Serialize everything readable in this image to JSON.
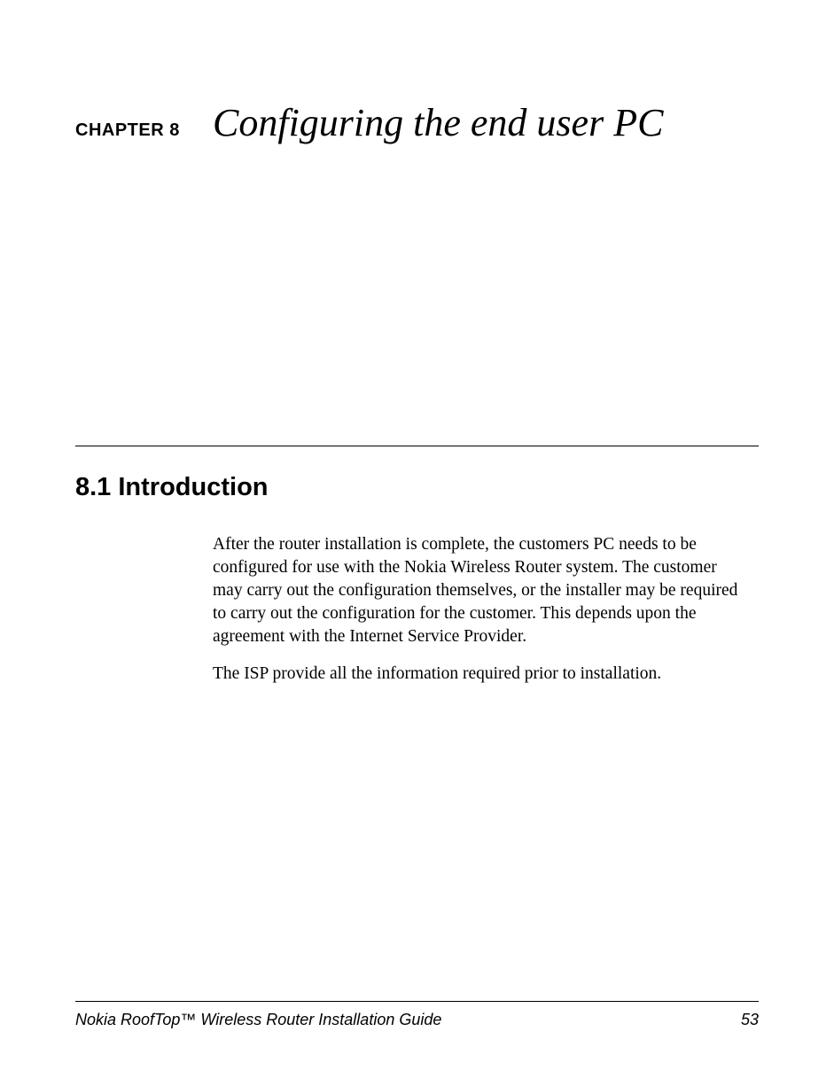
{
  "header": {
    "chapter_label": "CHAPTER 8",
    "chapter_title": "Configuring the end user PC"
  },
  "section": {
    "heading": "8.1 Introduction",
    "paragraphs": [
      "After the router installation is complete, the customers PC needs to be configured for use with the Nokia Wireless Router system. The customer may carry out the configuration themselves, or the installer may be required to carry out the configuration for the customer. This depends upon the agreement with the Internet Service Provider.",
      "The ISP provide all the information required prior to installation."
    ]
  },
  "footer": {
    "guide_title": "Nokia RoofTop™ Wireless Router Installation Guide",
    "page_number": "53"
  }
}
